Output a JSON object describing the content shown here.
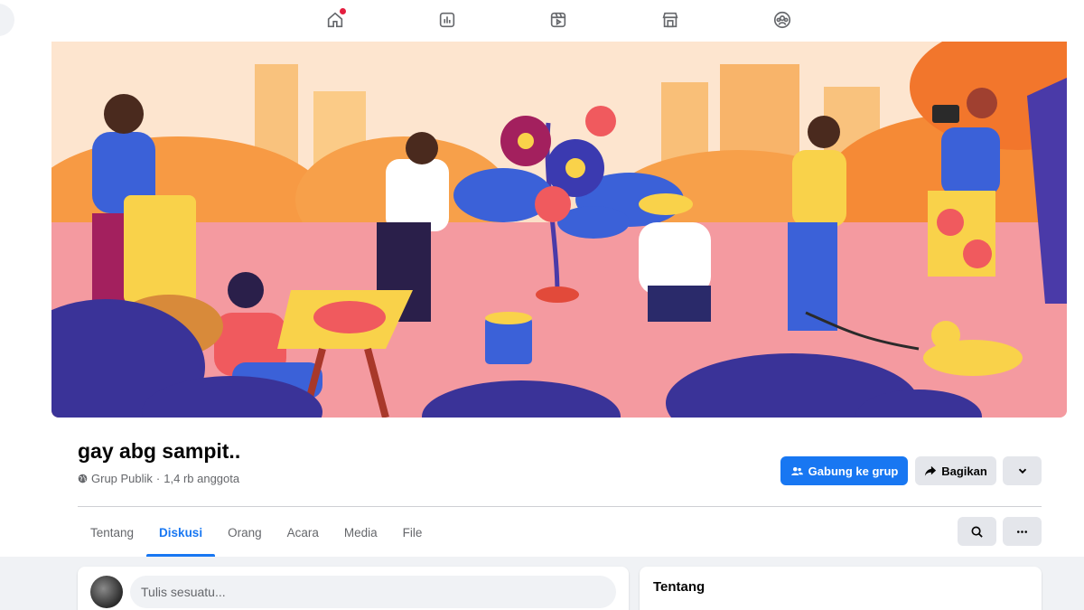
{
  "nav": {
    "icons": [
      "home-icon",
      "chart-icon",
      "video-icon",
      "marketplace-icon",
      "groups-icon"
    ],
    "home_has_notification": true
  },
  "group": {
    "name": "gay abg sampit..",
    "privacy": "Grup Publik",
    "separator": "·",
    "members": "1,4 rb anggota"
  },
  "actions": {
    "join_label": "Gabung ke grup",
    "share_label": "Bagikan"
  },
  "tabs": [
    {
      "label": "Tentang",
      "active": false
    },
    {
      "label": "Diskusi",
      "active": true
    },
    {
      "label": "Orang",
      "active": false
    },
    {
      "label": "Acara",
      "active": false
    },
    {
      "label": "Media",
      "active": false
    },
    {
      "label": "File",
      "active": false
    }
  ],
  "composer": {
    "placeholder": "Tulis sesuatu..."
  },
  "about": {
    "title": "Tentang"
  },
  "colors": {
    "accent": "#1877f2",
    "secondary_button": "#e4e6eb",
    "page_bg": "#f0f2f5",
    "notification": "#e41e3f"
  }
}
